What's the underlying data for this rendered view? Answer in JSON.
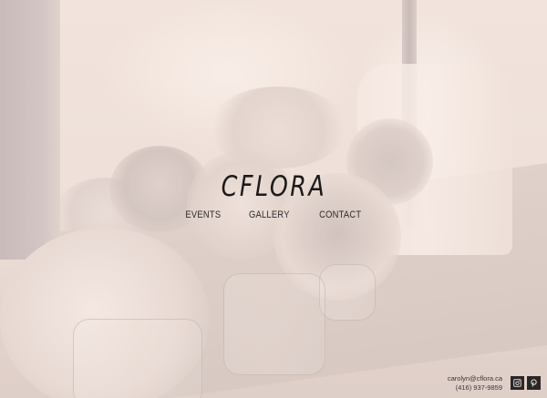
{
  "brand": {
    "logo_text": "CFLORA"
  },
  "nav": {
    "items": [
      {
        "label": "EVENTS"
      },
      {
        "label": "GALLERY"
      },
      {
        "label": "CONTACT"
      }
    ]
  },
  "contact": {
    "email": "carolyn@cflora.ca",
    "phone": "(416) 937-9859"
  },
  "social": {
    "icons": [
      "instagram-icon",
      "pinterest-icon"
    ]
  },
  "colors": {
    "text_dark": "#1c1a1a",
    "social_bg": "#2b2626",
    "background_tint": "#e9dcd6"
  }
}
